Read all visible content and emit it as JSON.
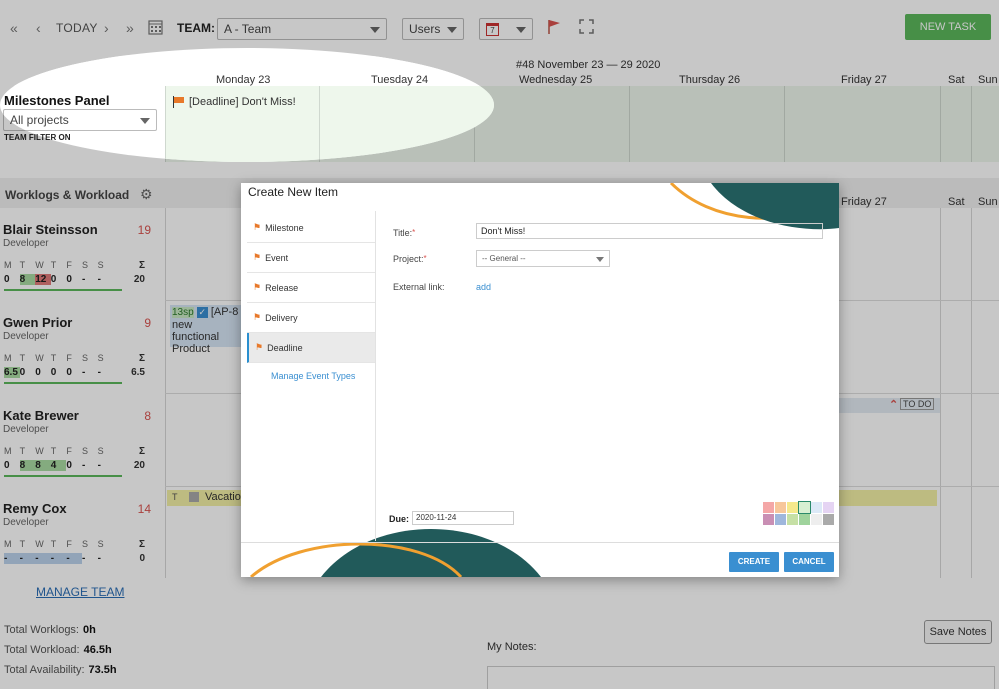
{
  "toolbar": {
    "today_label": "TODAY",
    "team_label": "TEAM:",
    "team_value": "A - Team",
    "users_value": "Users",
    "calendar_day": "7",
    "new_task_label": "NEW TASK"
  },
  "calendar": {
    "week_label": "#48 November 23 — 29 2020",
    "days": [
      "Monday 23",
      "Tuesday 24",
      "Wednesday 25",
      "Thursday 26",
      "Friday 27",
      "Sat",
      "Sun"
    ]
  },
  "milestones": {
    "panel_title": "Milestones Panel",
    "project_filter": "All projects",
    "filter_status": "TEAM FILTER ON",
    "event_text": "[Deadline] Don't Miss!"
  },
  "worklogs": {
    "title": "Worklogs & Workload",
    "weekday_letters": [
      "M",
      "T",
      "W",
      "T",
      "F",
      "S",
      "S"
    ],
    "sum_symbol": "Σ",
    "people": [
      {
        "name": "Blair Steinsson",
        "role": "Developer",
        "count": "19",
        "values": [
          "0",
          "8",
          "12",
          "0",
          "0",
          "-",
          "-"
        ],
        "sum": "20"
      },
      {
        "name": "Gwen Prior",
        "role": "Developer",
        "count": "9",
        "values": [
          "6.5",
          "0",
          "0",
          "0",
          "0",
          "-",
          "-"
        ],
        "sum": "6.5"
      },
      {
        "name": "Kate Brewer",
        "role": "Developer",
        "count": "8",
        "values": [
          "0",
          "8",
          "8",
          "4",
          "0",
          "-",
          "-"
        ],
        "sum": "20"
      },
      {
        "name": "Remy Cox",
        "role": "Developer",
        "count": "14",
        "values": [
          "-",
          "-",
          "-",
          "-",
          "-",
          "-",
          "-"
        ],
        "sum": "0"
      }
    ],
    "task_snippet": {
      "sp": "13sp",
      "key": "[AP-8",
      "line2": "new functional",
      "line3": "Product"
    },
    "vacation": "Vacation",
    "todo_badge": "TO DO"
  },
  "footer": {
    "manage_team": "MANAGE TEAM",
    "total_worklogs_label": "Total Worklogs:",
    "total_worklogs": "0h",
    "total_workload_label": "Total Workload:",
    "total_workload": "46.5h",
    "total_availability_label": "Total Availability:",
    "total_availability": "73.5h",
    "my_notes": "My Notes:",
    "save_notes": "Save Notes"
  },
  "modal": {
    "title": "Create New Item",
    "types": [
      "Milestone",
      "Event",
      "Release",
      "Delivery",
      "Deadline"
    ],
    "selected_type": "Deadline",
    "manage_types": "Manage Event Types",
    "title_label": "Title:",
    "title_value": "Don't Miss!",
    "project_label": "Project:",
    "project_value": "-- General --",
    "external_link_label": "External link:",
    "external_link_action": "add",
    "due_label": "Due:",
    "due_value": "2020-11-24",
    "create_label": "CREATE",
    "cancel_label": "CANCEL",
    "swatch_colors": [
      "#f4a7a7",
      "#f7c79b",
      "#f5e98c",
      "#d8f0d2",
      "#dce9f7",
      "#e5d4f3",
      "#c98fb4",
      "#9fb7dc",
      "#c6e0a5",
      "#9fd39c",
      "#eeeeee",
      "#aaaaaa"
    ]
  }
}
